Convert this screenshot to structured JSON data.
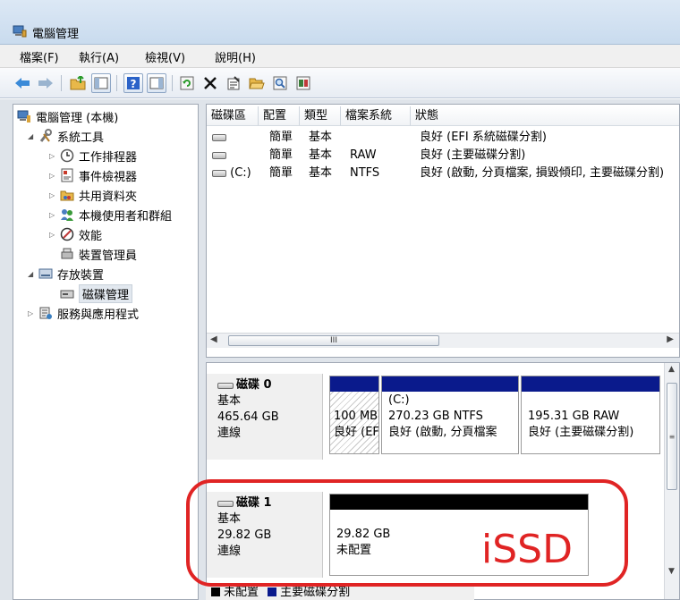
{
  "window": {
    "title": "電腦管理",
    "icon": "computer-management-icon"
  },
  "menu": [
    "檔案(F)",
    "執行(A)",
    "檢視(V)",
    "說明(H)"
  ],
  "toolbar": [
    "back-arrow-icon",
    "forward-arrow-icon",
    "up-folder-icon",
    "show-hide-tree-icon",
    "help-icon",
    "action-pane-icon",
    "refresh-icon",
    "delete-icon",
    "properties-icon",
    "open-icon",
    "search-icon",
    "settings-icon"
  ],
  "tree": {
    "root": "電腦管理 (本機)",
    "system_tools": "系統工具",
    "task_scheduler": "工作排程器",
    "event_viewer": "事件檢視器",
    "shared_folders": "共用資料夾",
    "local_users": "本機使用者和群組",
    "performance": "效能",
    "device_manager": "裝置管理員",
    "storage": "存放裝置",
    "disk_management": "磁碟管理",
    "services": "服務與應用程式"
  },
  "volume_list": {
    "headers": [
      "磁碟區",
      "配置",
      "類型",
      "檔案系統",
      "狀態"
    ],
    "rows": [
      {
        "volume": "",
        "layout": "簡單",
        "type": "基本",
        "fs": "",
        "status": "良好 (EFI 系統磁碟分割)"
      },
      {
        "volume": "",
        "layout": "簡單",
        "type": "基本",
        "fs": "RAW",
        "status": "良好 (主要磁碟分割)"
      },
      {
        "volume": "(C:)",
        "layout": "簡單",
        "type": "基本",
        "fs": "NTFS",
        "status": "良好 (啟動, 分頁檔案, 損毀傾印, 主要磁碟分割)"
      }
    ],
    "scroll_glyph": "III"
  },
  "disks": [
    {
      "name": "磁碟 0",
      "type": "基本",
      "size": "465.64 GB",
      "status": "連線",
      "partitions": [
        {
          "line1": "",
          "line2": "100 MB",
          "line3": "良好 (EFI 系統磁碟分割)"
        },
        {
          "line1": "(C:)",
          "line2": "270.23 GB NTFS",
          "line3": "良好 (啟動, 分頁檔案"
        },
        {
          "line1": "",
          "line2": "195.31 GB RAW",
          "line3": "良好 (主要磁碟分割)"
        }
      ]
    },
    {
      "name": "磁碟 1",
      "type": "基本",
      "size": "29.82 GB",
      "status": "連線",
      "partitions": [
        {
          "line1": "",
          "line2": "29.82 GB",
          "line3": "未配置"
        }
      ]
    }
  ],
  "legend": {
    "unallocated": "未配置",
    "primary": "主要磁碟分割"
  },
  "annotation": "iSSD",
  "colors": {
    "primary_bar": "#0a1a8c",
    "unallocated_bar": "#000000",
    "annotation": "#e02424"
  }
}
